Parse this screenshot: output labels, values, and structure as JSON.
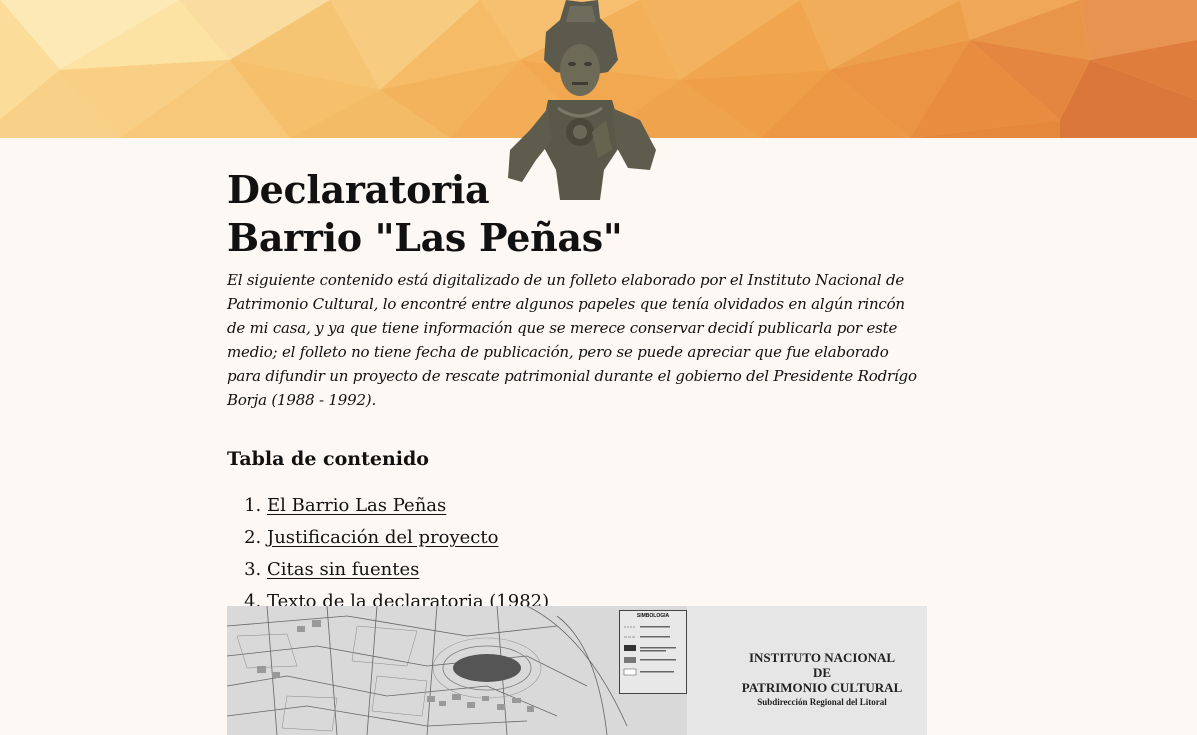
{
  "header": {
    "colors": {
      "banner_light": "#fce7b0",
      "banner_mid": "#f4b05a",
      "banner_dark": "#d8743a"
    },
    "statue_icon": "mayan-statue"
  },
  "article": {
    "title_line1": "Declaratoria",
    "title_line2": "Barrio \"Las Peñas\"",
    "intro": "El siguiente contenido está digitalizado de un folleto elaborado por el Instituto Nacional de Patrimonio Cultural, lo encontré entre algunos papeles que tenía olvidados en algún rincón de mi casa, y ya que tiene información que se merece conservar decidí publicarla por este medio; el folleto no tiene fecha de publicación, pero se puede apreciar que fue elaborado para difundir un proyecto de rescate patrimonial durante el gobierno del Presidente Rodrígo Borja (1988 - 1992)."
  },
  "toc": {
    "heading": "Tabla de contenido",
    "items": [
      {
        "label": "El Barrio Las Peñas"
      },
      {
        "label": "Justificación del proyecto"
      },
      {
        "label": "Citas sin fuentes"
      },
      {
        "label": "Texto de la declaratoria (1982)"
      }
    ]
  },
  "map_image": {
    "legend_title": "SIMBOLOGIA",
    "institute_line1": "INSTITUTO NACIONAL",
    "institute_line2": "DE",
    "institute_line3": "PATRIMONIO CULTURAL",
    "institute_line4": "Subdirección Regional del Litoral"
  }
}
